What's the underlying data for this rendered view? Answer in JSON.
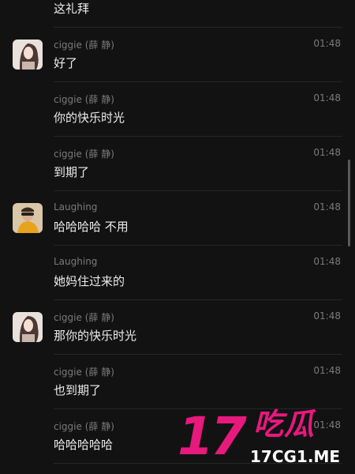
{
  "colors": {
    "background": "#121212",
    "meta_text": "#7a7a7a",
    "message_text": "#ececec",
    "watermark_pink": "#e6197d"
  },
  "messages": [
    {
      "sender": "",
      "time": "",
      "text": "这礼拜",
      "avatar": ""
    },
    {
      "sender": "ciggie (薛 静)",
      "time": "01:48",
      "text": "好了",
      "avatar": "ciggie-avatar"
    },
    {
      "sender": "ciggie (薛 静)",
      "time": "01:48",
      "text": "你的快乐时光",
      "avatar": ""
    },
    {
      "sender": "ciggie (薛 静)",
      "time": "01:48",
      "text": "到期了",
      "avatar": ""
    },
    {
      "sender": "Laughing",
      "time": "01:48",
      "text": "哈哈哈哈 不用",
      "avatar": "laughing-avatar"
    },
    {
      "sender": "Laughing",
      "time": "01:48",
      "text": "她妈住过来的",
      "avatar": ""
    },
    {
      "sender": "ciggie (薛 静)",
      "time": "01:48",
      "text": "那你的快乐时光",
      "avatar": "ciggie-avatar"
    },
    {
      "sender": "ciggie (薛 静)",
      "time": "01:48",
      "text": "也到期了",
      "avatar": ""
    },
    {
      "sender": "ciggie (薛 静)",
      "time": "01:48",
      "text": "哈哈哈哈哈",
      "avatar": ""
    }
  ],
  "watermark": {
    "number": "17",
    "chinese": "吃瓜",
    "url": "17CG1.ME"
  }
}
